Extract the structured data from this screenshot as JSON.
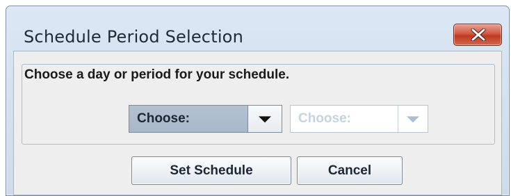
{
  "window": {
    "title": "Schedule Period Selection",
    "close_icon": "close-icon"
  },
  "group": {
    "legend": "Choose a day or period for your schedule."
  },
  "combos": {
    "primary": {
      "value": "Choose:",
      "enabled": true,
      "icon": "chevron-down-icon"
    },
    "secondary": {
      "value": "Choose:",
      "enabled": false,
      "icon": "chevron-down-icon"
    }
  },
  "buttons": {
    "set_schedule": "Set Schedule",
    "cancel": "Cancel"
  },
  "colors": {
    "close_button": "#c8452c",
    "selected_combo": "#aab9cb",
    "disabled_text": "#c6d3e0"
  }
}
